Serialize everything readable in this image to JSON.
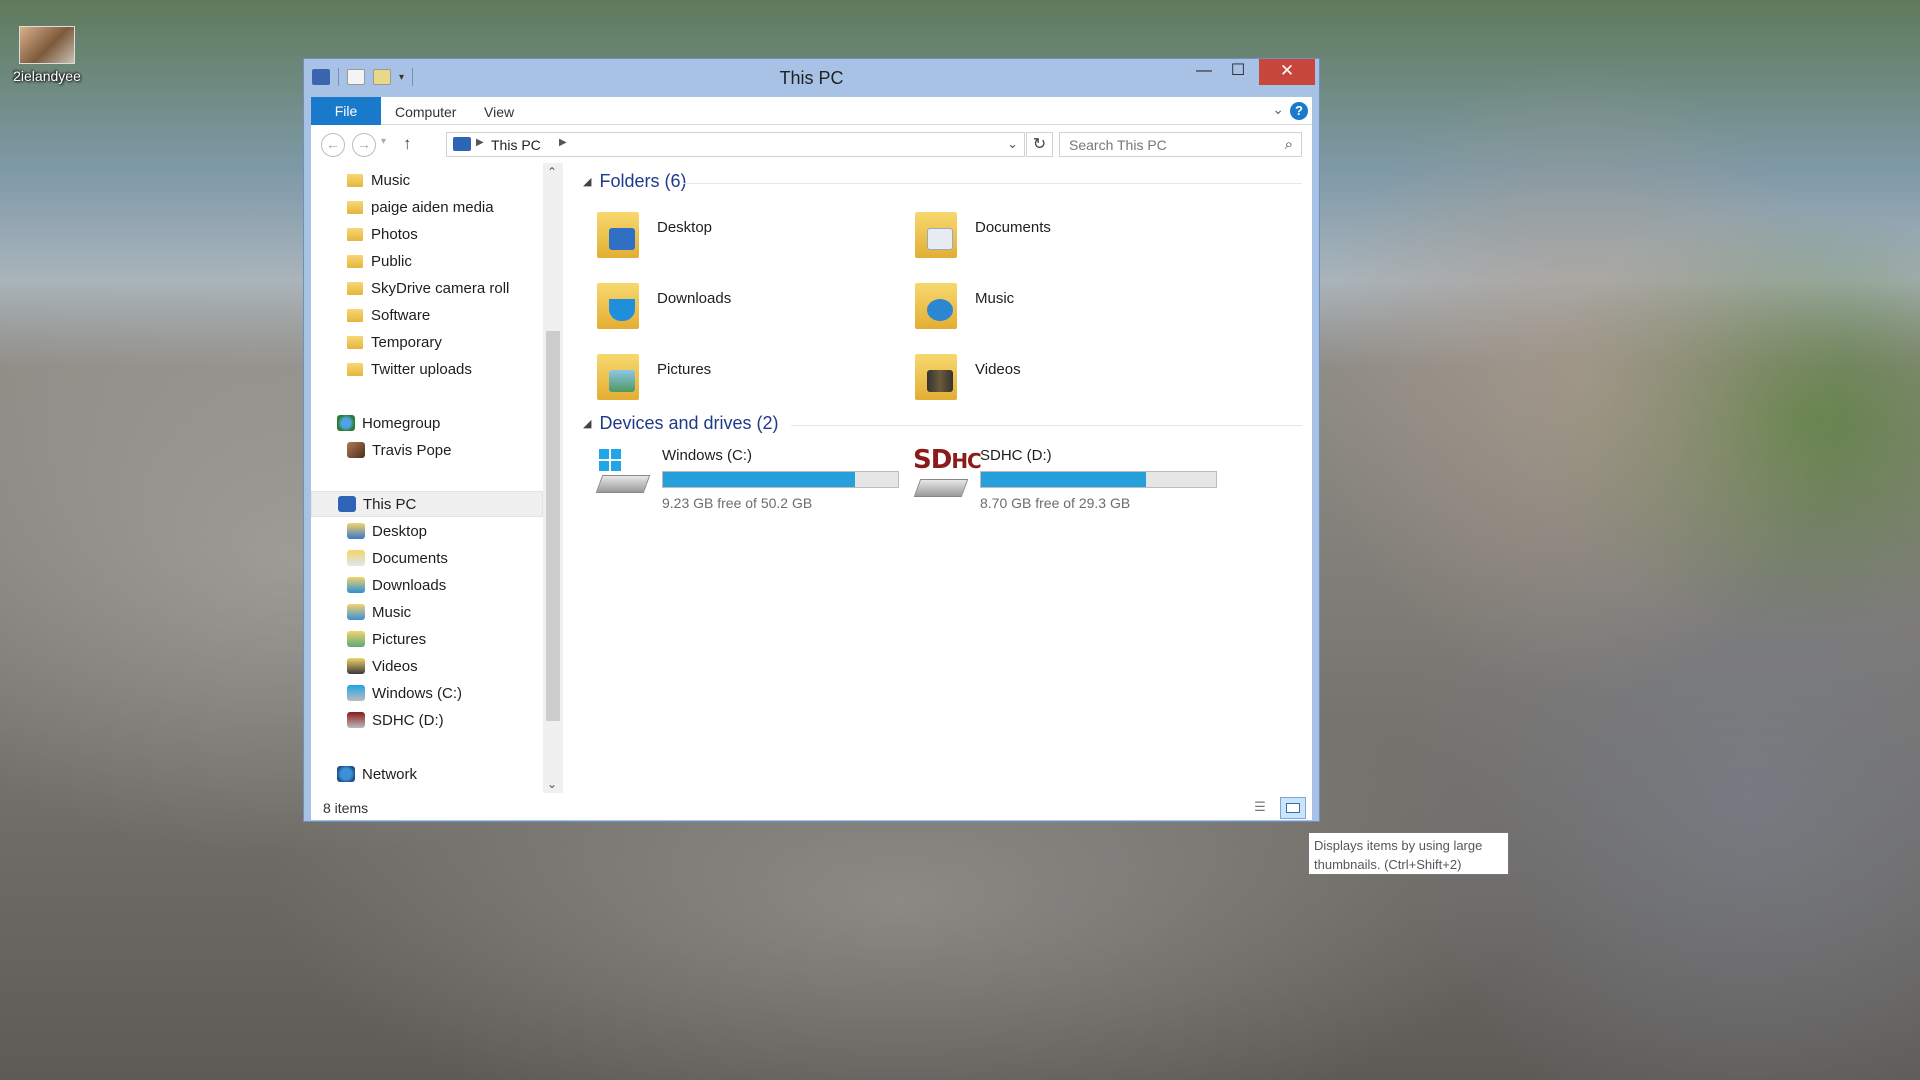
{
  "desktop": {
    "icon_label": "2ielandyee"
  },
  "window": {
    "title": "This PC",
    "controls": {
      "minimize": "—",
      "maximize": "☐",
      "close": "✕"
    },
    "ribbon": {
      "file": "File",
      "computer": "Computer",
      "view": "View",
      "expand": "⌄",
      "help": "?"
    },
    "address": {
      "location": "This PC",
      "dropdown": "⌄",
      "refresh": "↻"
    },
    "search": {
      "placeholder": "Search This PC"
    },
    "nav_pane": {
      "user_folders": [
        "Music",
        "paige aiden media",
        "Photos",
        "Public",
        "SkyDrive camera roll",
        "Software",
        "Temporary",
        "Twitter uploads"
      ],
      "homegroup": "Homegroup",
      "homegroup_user": "Travis Pope",
      "this_pc": "This PC",
      "this_pc_items": [
        "Desktop",
        "Documents",
        "Downloads",
        "Music",
        "Pictures",
        "Videos",
        "Windows (C:)",
        "SDHC (D:)"
      ],
      "network": "Network"
    },
    "folders_group": {
      "header": "Folders (6)",
      "items": [
        "Desktop",
        "Documents",
        "Downloads",
        "Music",
        "Pictures",
        "Videos"
      ]
    },
    "drives_group": {
      "header": "Devices and drives (2)",
      "drives": [
        {
          "name": "Windows (C:)",
          "free_text": "9.23 GB free of 50.2 GB",
          "used_fraction": 0.816
        },
        {
          "name": "SDHC (D:)",
          "free_text": "8.70 GB free of 29.3 GB",
          "used_fraction": 0.703,
          "logo_text": "SD HC"
        }
      ]
    },
    "status": {
      "items": "8 items"
    }
  },
  "tooltip": {
    "text": "Displays items by using large thumbnails.  (Ctrl+Shift+2)"
  },
  "colors": {
    "accent": "#1979ca",
    "close": "#c7473c",
    "bar": "#26a0da",
    "frame": "#a7c2e5"
  }
}
